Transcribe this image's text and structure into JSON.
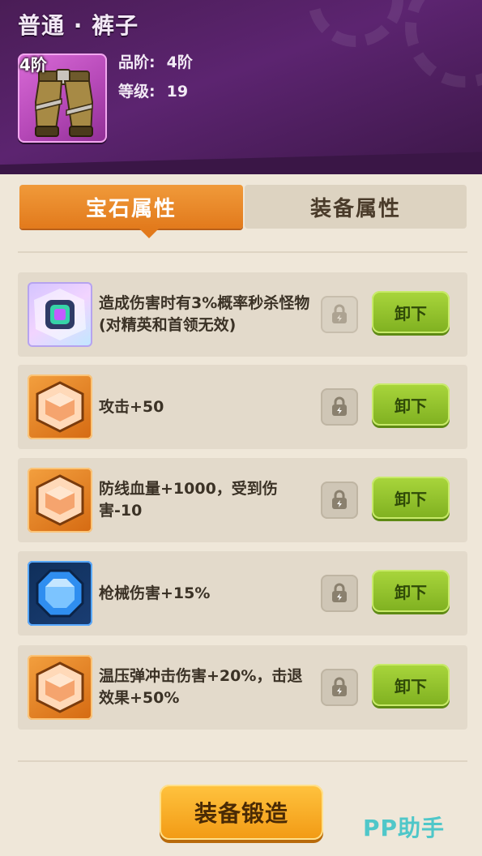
{
  "header": {
    "title": "普通 · 裤子",
    "item_tier_badge": "4阶",
    "item_icon": "pants-icon",
    "stats": [
      {
        "label": "品阶:",
        "value": "4阶"
      },
      {
        "label": "等级:",
        "value": "19"
      }
    ]
  },
  "tabs": [
    {
      "label": "宝石属性",
      "active": true
    },
    {
      "label": "装备属性",
      "active": false
    }
  ],
  "gems": [
    {
      "icon": "rainbow-gem-icon",
      "text": "造成伤害时有3%概率秒杀怪物(对精英和首领无效)",
      "button": "卸下",
      "lock_icon": "lock-icon"
    },
    {
      "icon": "orange-gem-icon",
      "text": "攻击+50",
      "button": "卸下",
      "lock_icon": "lock-icon"
    },
    {
      "icon": "orange-gem-icon",
      "text": "防线血量+1000，受到伤害-10",
      "button": "卸下",
      "lock_icon": "lock-icon"
    },
    {
      "icon": "blue-gem-icon",
      "text": "枪械伤害+15%",
      "button": "卸下",
      "lock_icon": "lock-icon"
    },
    {
      "icon": "orange-gem-icon",
      "text": "温压弹冲击伤害+20%，击退效果+50%",
      "button": "卸下",
      "lock_icon": "lock-icon"
    }
  ],
  "footer": {
    "forge_button": "装备锻造",
    "watermark": "PP助手"
  },
  "colors": {
    "header_purple": "#5c2470",
    "tab_active_orange": "#e27a1c",
    "button_green": "#8fc12a",
    "forge_gold": "#f5a623",
    "background": "#efe7d9"
  }
}
